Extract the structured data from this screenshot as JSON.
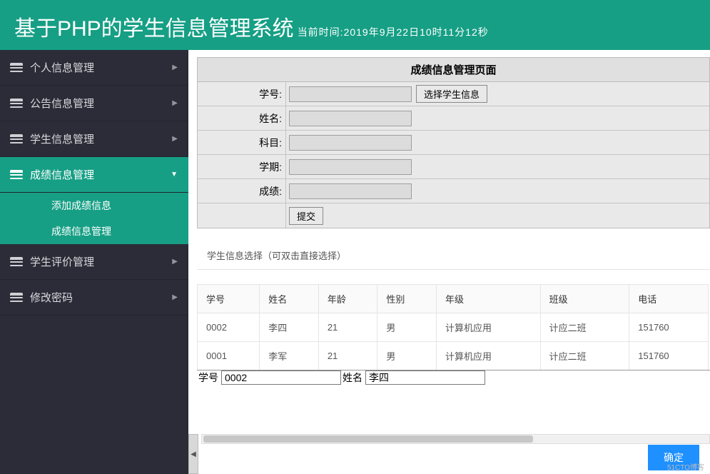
{
  "header": {
    "title": "基于PHP的学生信息管理系统",
    "time_label": "当前时间:2019年9月22日10时11分12秒"
  },
  "sidebar": {
    "items": [
      {
        "label": "个人信息管理",
        "active": false
      },
      {
        "label": "公告信息管理",
        "active": false
      },
      {
        "label": "学生信息管理",
        "active": false
      },
      {
        "label": "成绩信息管理",
        "active": true
      },
      {
        "label": "学生评价管理",
        "active": false
      },
      {
        "label": "修改密码",
        "active": false
      }
    ],
    "submenu": [
      {
        "label": "添加成绩信息"
      },
      {
        "label": "成绩信息管理"
      }
    ]
  },
  "form": {
    "title": "成绩信息管理页面",
    "fields": {
      "student_id_label": "学号:",
      "select_student_btn": "选择学生信息",
      "name_label": "姓名:",
      "subject_label": "科目:",
      "term_label": "学期:",
      "score_label": "成绩:",
      "submit_btn": "提交"
    }
  },
  "select_panel": {
    "title": "学生信息选择（可双击直接选择）",
    "columns": [
      "学号",
      "姓名",
      "年龄",
      "性别",
      "年级",
      "班级",
      "电话"
    ],
    "rows": [
      {
        "id": "0002",
        "name": "李四",
        "age": "21",
        "gender": "男",
        "grade": "计算机应用",
        "class": "计应二班",
        "phone": "151760"
      },
      {
        "id": "0001",
        "name": "李军",
        "age": "21",
        "gender": "男",
        "grade": "计算机应用",
        "class": "计应二班",
        "phone": "151760"
      }
    ],
    "filter": {
      "id_label": "学号",
      "id_value": "0002",
      "name_label": "姓名",
      "name_value": "李四"
    },
    "confirm_btn": "确定"
  },
  "watermark": "51CTO博客"
}
